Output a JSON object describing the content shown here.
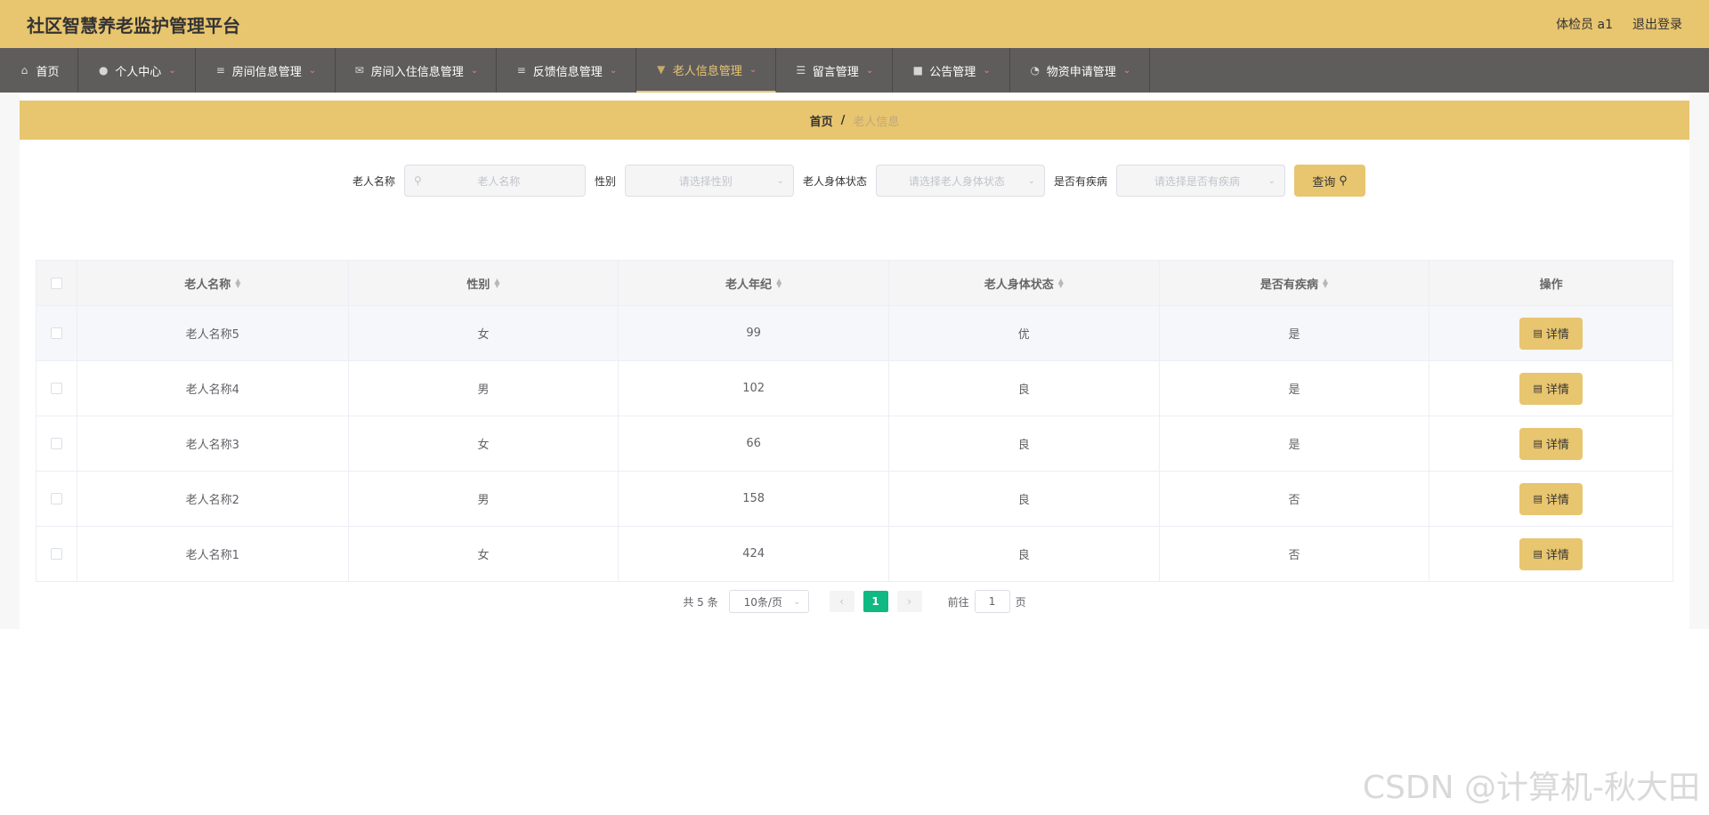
{
  "header": {
    "title": "社区智慧养老监护管理平台",
    "user": "体检员 a1",
    "logout": "退出登录"
  },
  "nav": {
    "items": [
      {
        "label": "首页",
        "icon": "home-icon"
      },
      {
        "label": "个人中心",
        "icon": "user-icon"
      },
      {
        "label": "房间信息管理",
        "icon": "list-icon"
      },
      {
        "label": "房间入住信息管理",
        "icon": "mail-icon"
      },
      {
        "label": "反馈信息管理",
        "icon": "list-icon"
      },
      {
        "label": "老人信息管理",
        "icon": "pin-icon"
      },
      {
        "label": "留言管理",
        "icon": "sliders-icon"
      },
      {
        "label": "公告管理",
        "icon": "notice-icon"
      },
      {
        "label": "物资申请管理",
        "icon": "gauge-icon"
      }
    ]
  },
  "breadcrumb": {
    "home": "首页",
    "sep": "/",
    "current": "老人信息"
  },
  "search": {
    "name_label": "老人名称",
    "name_placeholder": "老人名称",
    "gender_label": "性别",
    "gender_placeholder": "请选择性别",
    "status_label": "老人身体状态",
    "status_placeholder": "请选择老人身体状态",
    "disease_label": "是否有疾病",
    "disease_placeholder": "请选择是否有疾病",
    "query_label": "查询"
  },
  "table": {
    "headers": [
      "老人名称",
      "性别",
      "老人年纪",
      "老人身体状态",
      "是否有疾病",
      "操作"
    ],
    "rows": [
      {
        "name": "老人名称5",
        "gender": "女",
        "age": "99",
        "status": "优",
        "disease": "是"
      },
      {
        "name": "老人名称4",
        "gender": "男",
        "age": "102",
        "status": "良",
        "disease": "是"
      },
      {
        "name": "老人名称3",
        "gender": "女",
        "age": "66",
        "status": "良",
        "disease": "是"
      },
      {
        "name": "老人名称2",
        "gender": "男",
        "age": "158",
        "status": "良",
        "disease": "否"
      },
      {
        "name": "老人名称1",
        "gender": "女",
        "age": "424",
        "status": "良",
        "disease": "否"
      }
    ],
    "detail_label": "详情"
  },
  "pager": {
    "total": "共 5 条",
    "page_size": "10条/页",
    "current_page": "1",
    "goto_label": "前往",
    "goto_value": "1",
    "page_suffix": "页"
  },
  "watermark": "CSDN @计算机-秋大田",
  "colors": {
    "accent": "#e8c56f",
    "nav_bg": "#5f5d5c",
    "page_active": "#10b981"
  }
}
